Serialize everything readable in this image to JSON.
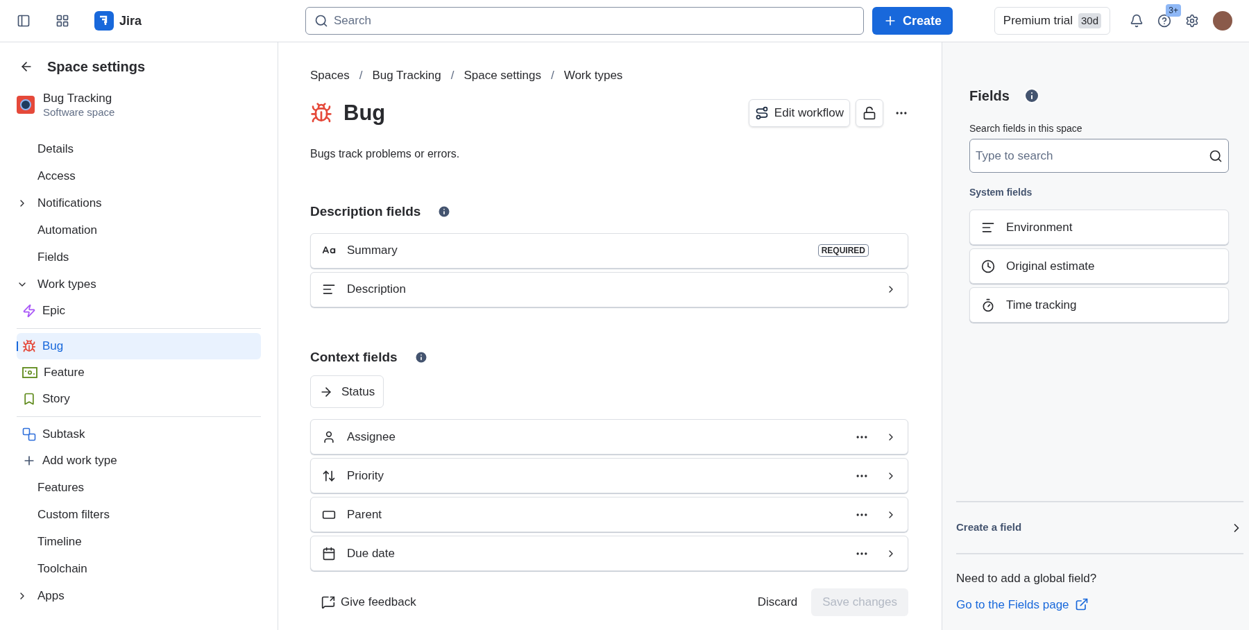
{
  "top_bar": {
    "product": "Jira",
    "search": {
      "placeholder": "Search"
    },
    "create_button": "Create",
    "trial": {
      "label": "Premium trial",
      "badge": "30d"
    },
    "help_badge": "3+"
  },
  "sidebar": {
    "title": "Space settings",
    "space": {
      "name": "Bug Tracking",
      "type": "Software space"
    },
    "items": [
      {
        "label": "Details",
        "kind": "link"
      },
      {
        "label": "Access",
        "kind": "link"
      },
      {
        "label": "Notifications",
        "kind": "group",
        "expanded": false
      },
      {
        "label": "Automation",
        "kind": "link"
      },
      {
        "label": "Fields",
        "kind": "link"
      },
      {
        "label": "Work types",
        "kind": "group",
        "expanded": true,
        "children": [
          {
            "label": "Epic",
            "kind": "epic",
            "selected": false,
            "divider_before": false
          },
          {
            "label": "Bug",
            "kind": "bug",
            "selected": true,
            "divider_before": true
          },
          {
            "label": "Feature",
            "kind": "feature",
            "selected": false,
            "divider_before": false
          },
          {
            "label": "Story",
            "kind": "story",
            "selected": false,
            "divider_before": false
          },
          {
            "label": "Subtask",
            "kind": "subtask",
            "selected": false,
            "divider_before": true
          },
          {
            "label": "Add work type",
            "kind": "add",
            "selected": false,
            "divider_before": false
          }
        ]
      },
      {
        "label": "Features",
        "kind": "link"
      },
      {
        "label": "Custom filters",
        "kind": "link"
      },
      {
        "label": "Timeline",
        "kind": "link"
      },
      {
        "label": "Toolchain",
        "kind": "link"
      },
      {
        "label": "Apps",
        "kind": "group",
        "expanded": false
      }
    ]
  },
  "main": {
    "breadcrumbs": [
      "Spaces",
      "Bug Tracking",
      "Space settings",
      "Work types"
    ],
    "breadcrumb_separator": "/",
    "title": "Bug",
    "edit_workflow": "Edit workflow",
    "description": "Bugs track problems or errors.",
    "description_fields": {
      "heading": "Description fields",
      "fields": [
        {
          "label": "Summary",
          "kind": "text",
          "badge": "REQUIRED"
        },
        {
          "label": "Description",
          "kind": "paragraph",
          "chevron": true
        }
      ]
    },
    "context_fields": {
      "heading": "Context fields",
      "status": "Status",
      "fields": [
        {
          "label": "Assignee",
          "kind": "person",
          "more_menu": true,
          "chevron": true
        },
        {
          "label": "Priority",
          "kind": "sort",
          "more_menu": true,
          "chevron": true
        },
        {
          "label": "Parent",
          "kind": "parent",
          "more_menu": true,
          "chevron": true
        },
        {
          "label": "Due date",
          "kind": "calendar",
          "more_menu": true,
          "chevron": true
        }
      ]
    },
    "footer": {
      "feedback": "Give feedback",
      "discard": "Discard",
      "save": {
        "label": "Save changes",
        "disabled": true
      }
    }
  },
  "fields_panel": {
    "title": "Fields",
    "search_label": "Search fields in this space",
    "search": {
      "placeholder": "Type to search"
    },
    "section": "System fields",
    "fields": [
      {
        "label": "Environment",
        "kind": "paragraph"
      },
      {
        "label": "Original estimate",
        "kind": "clock"
      },
      {
        "label": "Time tracking",
        "kind": "stopwatch"
      }
    ],
    "create_field": "Create a field",
    "global_prompt": "Need to add a global field?",
    "global_link": "Go to the Fields page"
  }
}
